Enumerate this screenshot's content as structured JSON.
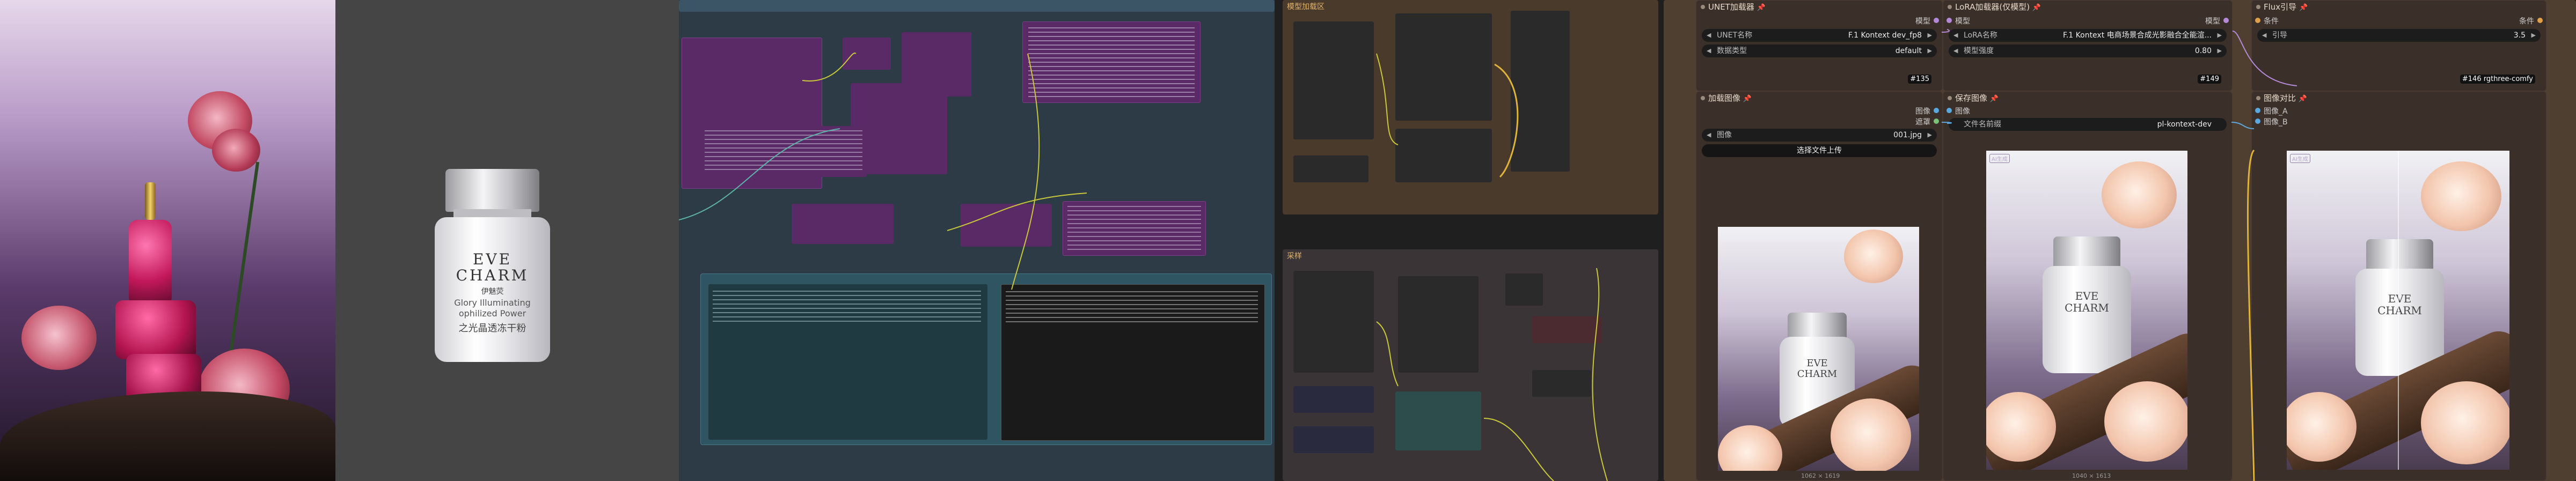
{
  "groups": {
    "model_loading": "模型加载区",
    "sampling": "采样"
  },
  "reference_image": {
    "brand_lines": [
      "EVE",
      "CHARM"
    ],
    "brand_cn": "伊魅荧",
    "product_lines": [
      "Glory Illuminating",
      "ophilized Power",
      "之光晶透冻干粉"
    ]
  },
  "nodes": {
    "unet": {
      "title": "UNET加载器",
      "rows": [
        {
          "label": "UNET名称",
          "value": "F.1 Kontext dev_fp8"
        },
        {
          "label": "数据类型",
          "value": "default"
        }
      ],
      "output_label": "模型",
      "id": "#135"
    },
    "lora": {
      "title": "LoRA加载器(仅模型)",
      "input_label": "模型",
      "output_label": "模型",
      "rows": [
        {
          "label": "LoRA名称",
          "value": "F.1 Kontext 电商场景合成光影融合全能渲..."
        },
        {
          "label": "模型强度",
          "value": "0.80"
        }
      ],
      "id": "#149"
    },
    "flux_guidance": {
      "title": "Flux引导",
      "input_label": "条件",
      "output_label": "条件",
      "rows": [
        {
          "label": "引导",
          "value": "3.5"
        }
      ],
      "id": "#146 rgthree-comfy"
    },
    "load_image": {
      "title": "加载图像",
      "out_image": "图像",
      "out_mask": "遮罩",
      "rows": [
        {
          "label": "图像",
          "value": "001.jpg"
        }
      ],
      "upload_button": "选择文件上传",
      "caption": "1062 × 1619"
    },
    "save_image": {
      "title": "保存图像",
      "input_label": "图像",
      "rows": [
        {
          "label": "文件名前缀",
          "value": "pl-kontext-dev"
        }
      ],
      "tag": "AI生成",
      "caption": "1040 × 1613"
    },
    "compare": {
      "title": "图像对比",
      "input_a": "图像_A",
      "input_b": "图像_B",
      "tag": "AI生成"
    }
  },
  "colors": {
    "accent_pin": "#e03c3c",
    "node_bg": "#3b2f2a",
    "group_model": "#4a3a2c",
    "group_sampling": "#3a3436",
    "canvas": "#212121",
    "purple_node": "#5c2a66",
    "teal_group": "#2c4f5e"
  }
}
